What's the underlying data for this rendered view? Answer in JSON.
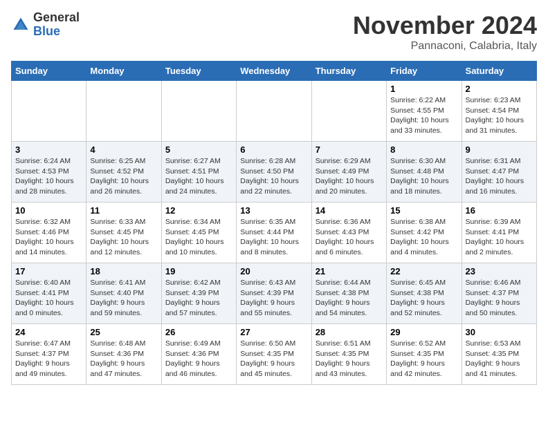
{
  "logo": {
    "text_general": "General",
    "text_blue": "Blue"
  },
  "header": {
    "month_year": "November 2024",
    "location": "Pannaconi, Calabria, Italy"
  },
  "weekdays": [
    "Sunday",
    "Monday",
    "Tuesday",
    "Wednesday",
    "Thursday",
    "Friday",
    "Saturday"
  ],
  "weeks": [
    [
      {
        "day": "",
        "detail": ""
      },
      {
        "day": "",
        "detail": ""
      },
      {
        "day": "",
        "detail": ""
      },
      {
        "day": "",
        "detail": ""
      },
      {
        "day": "",
        "detail": ""
      },
      {
        "day": "1",
        "detail": "Sunrise: 6:22 AM\nSunset: 4:55 PM\nDaylight: 10 hours and 33 minutes."
      },
      {
        "day": "2",
        "detail": "Sunrise: 6:23 AM\nSunset: 4:54 PM\nDaylight: 10 hours and 31 minutes."
      }
    ],
    [
      {
        "day": "3",
        "detail": "Sunrise: 6:24 AM\nSunset: 4:53 PM\nDaylight: 10 hours and 28 minutes."
      },
      {
        "day": "4",
        "detail": "Sunrise: 6:25 AM\nSunset: 4:52 PM\nDaylight: 10 hours and 26 minutes."
      },
      {
        "day": "5",
        "detail": "Sunrise: 6:27 AM\nSunset: 4:51 PM\nDaylight: 10 hours and 24 minutes."
      },
      {
        "day": "6",
        "detail": "Sunrise: 6:28 AM\nSunset: 4:50 PM\nDaylight: 10 hours and 22 minutes."
      },
      {
        "day": "7",
        "detail": "Sunrise: 6:29 AM\nSunset: 4:49 PM\nDaylight: 10 hours and 20 minutes."
      },
      {
        "day": "8",
        "detail": "Sunrise: 6:30 AM\nSunset: 4:48 PM\nDaylight: 10 hours and 18 minutes."
      },
      {
        "day": "9",
        "detail": "Sunrise: 6:31 AM\nSunset: 4:47 PM\nDaylight: 10 hours and 16 minutes."
      }
    ],
    [
      {
        "day": "10",
        "detail": "Sunrise: 6:32 AM\nSunset: 4:46 PM\nDaylight: 10 hours and 14 minutes."
      },
      {
        "day": "11",
        "detail": "Sunrise: 6:33 AM\nSunset: 4:45 PM\nDaylight: 10 hours and 12 minutes."
      },
      {
        "day": "12",
        "detail": "Sunrise: 6:34 AM\nSunset: 4:45 PM\nDaylight: 10 hours and 10 minutes."
      },
      {
        "day": "13",
        "detail": "Sunrise: 6:35 AM\nSunset: 4:44 PM\nDaylight: 10 hours and 8 minutes."
      },
      {
        "day": "14",
        "detail": "Sunrise: 6:36 AM\nSunset: 4:43 PM\nDaylight: 10 hours and 6 minutes."
      },
      {
        "day": "15",
        "detail": "Sunrise: 6:38 AM\nSunset: 4:42 PM\nDaylight: 10 hours and 4 minutes."
      },
      {
        "day": "16",
        "detail": "Sunrise: 6:39 AM\nSunset: 4:41 PM\nDaylight: 10 hours and 2 minutes."
      }
    ],
    [
      {
        "day": "17",
        "detail": "Sunrise: 6:40 AM\nSunset: 4:41 PM\nDaylight: 10 hours and 0 minutes."
      },
      {
        "day": "18",
        "detail": "Sunrise: 6:41 AM\nSunset: 4:40 PM\nDaylight: 9 hours and 59 minutes."
      },
      {
        "day": "19",
        "detail": "Sunrise: 6:42 AM\nSunset: 4:39 PM\nDaylight: 9 hours and 57 minutes."
      },
      {
        "day": "20",
        "detail": "Sunrise: 6:43 AM\nSunset: 4:39 PM\nDaylight: 9 hours and 55 minutes."
      },
      {
        "day": "21",
        "detail": "Sunrise: 6:44 AM\nSunset: 4:38 PM\nDaylight: 9 hours and 54 minutes."
      },
      {
        "day": "22",
        "detail": "Sunrise: 6:45 AM\nSunset: 4:38 PM\nDaylight: 9 hours and 52 minutes."
      },
      {
        "day": "23",
        "detail": "Sunrise: 6:46 AM\nSunset: 4:37 PM\nDaylight: 9 hours and 50 minutes."
      }
    ],
    [
      {
        "day": "24",
        "detail": "Sunrise: 6:47 AM\nSunset: 4:37 PM\nDaylight: 9 hours and 49 minutes."
      },
      {
        "day": "25",
        "detail": "Sunrise: 6:48 AM\nSunset: 4:36 PM\nDaylight: 9 hours and 47 minutes."
      },
      {
        "day": "26",
        "detail": "Sunrise: 6:49 AM\nSunset: 4:36 PM\nDaylight: 9 hours and 46 minutes."
      },
      {
        "day": "27",
        "detail": "Sunrise: 6:50 AM\nSunset: 4:35 PM\nDaylight: 9 hours and 45 minutes."
      },
      {
        "day": "28",
        "detail": "Sunrise: 6:51 AM\nSunset: 4:35 PM\nDaylight: 9 hours and 43 minutes."
      },
      {
        "day": "29",
        "detail": "Sunrise: 6:52 AM\nSunset: 4:35 PM\nDaylight: 9 hours and 42 minutes."
      },
      {
        "day": "30",
        "detail": "Sunrise: 6:53 AM\nSunset: 4:35 PM\nDaylight: 9 hours and 41 minutes."
      }
    ]
  ]
}
